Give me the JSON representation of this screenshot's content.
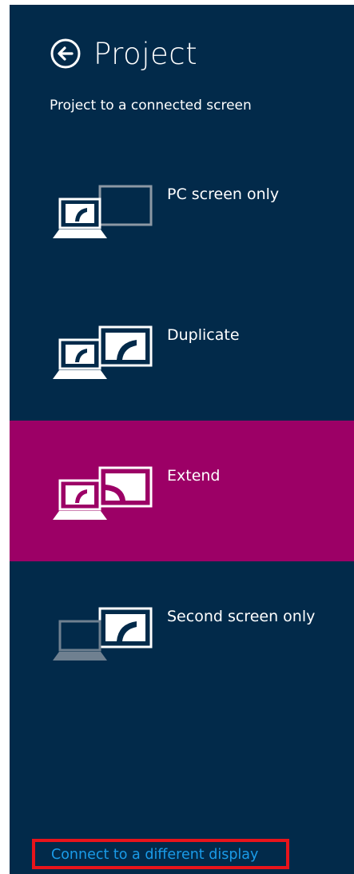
{
  "panel": {
    "title": "Project",
    "subtitle": "Project to a connected screen",
    "colors": {
      "background": "#022a4a",
      "selected": "#9c0066",
      "link": "#1a9be8",
      "highlight_box": "#e8141b"
    }
  },
  "options": [
    {
      "label": "PC screen only",
      "icon": "pc-screen-only-icon",
      "selected": false
    },
    {
      "label": "Duplicate",
      "icon": "duplicate-icon",
      "selected": false
    },
    {
      "label": "Extend",
      "icon": "extend-icon",
      "selected": true
    },
    {
      "label": "Second screen only",
      "icon": "second-screen-only-icon",
      "selected": false
    }
  ],
  "footer": {
    "connect_link": "Connect to a different display"
  }
}
